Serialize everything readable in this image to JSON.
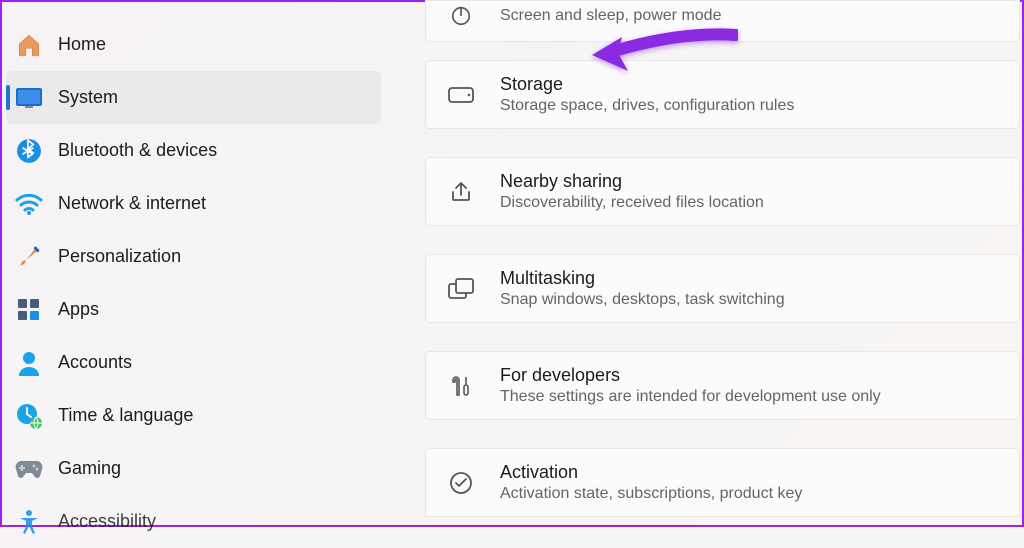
{
  "sidebar": {
    "items": [
      {
        "label": "Home"
      },
      {
        "label": "System"
      },
      {
        "label": "Bluetooth & devices"
      },
      {
        "label": "Network & internet"
      },
      {
        "label": "Personalization"
      },
      {
        "label": "Apps"
      },
      {
        "label": "Accounts"
      },
      {
        "label": "Time & language"
      },
      {
        "label": "Gaming"
      },
      {
        "label": "Accessibility"
      }
    ]
  },
  "main": {
    "cards": [
      {
        "title": "",
        "sub": "Screen and sleep, power mode"
      },
      {
        "title": "Storage",
        "sub": "Storage space, drives, configuration rules"
      },
      {
        "title": "Nearby sharing",
        "sub": "Discoverability, received files location"
      },
      {
        "title": "Multitasking",
        "sub": "Snap windows, desktops, task switching"
      },
      {
        "title": "For developers",
        "sub": "These settings are intended for development use only"
      },
      {
        "title": "Activation",
        "sub": "Activation state, subscriptions, product key"
      }
    ]
  },
  "annotation": {
    "color": "#8a2be2"
  }
}
